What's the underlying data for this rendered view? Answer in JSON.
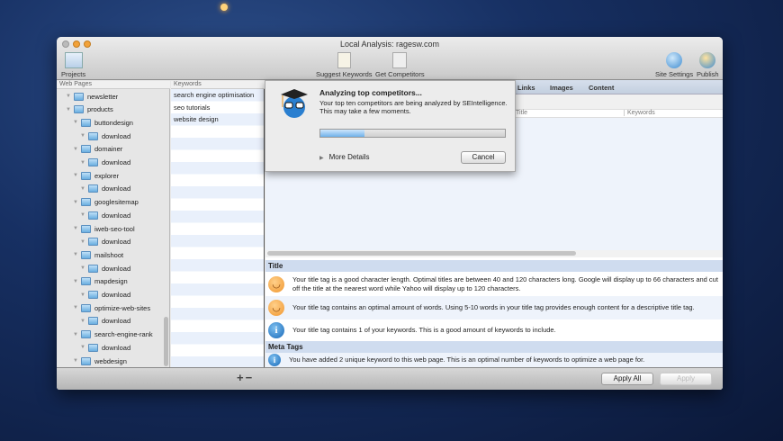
{
  "window": {
    "title": "Local Analysis: ragesw.com"
  },
  "toolbar": {
    "projects": "Projects",
    "suggest_keywords": "Suggest Keywords",
    "get_competitors": "Get Competitors",
    "site_settings": "Site Settings",
    "publish": "Publish"
  },
  "web_pages": {
    "header": "Web Pages",
    "items": [
      {
        "label": "newsletter",
        "level": 0
      },
      {
        "label": "products",
        "level": 0
      },
      {
        "label": "buttondesign",
        "level": 1
      },
      {
        "label": "download",
        "level": 2
      },
      {
        "label": "domainer",
        "level": 1
      },
      {
        "label": "download",
        "level": 2
      },
      {
        "label": "explorer",
        "level": 1
      },
      {
        "label": "download",
        "level": 2
      },
      {
        "label": "googlesitemap",
        "level": 1
      },
      {
        "label": "download",
        "level": 2
      },
      {
        "label": "iweb-seo-tool",
        "level": 1
      },
      {
        "label": "download",
        "level": 2
      },
      {
        "label": "mailshoot",
        "level": 1
      },
      {
        "label": "download",
        "level": 2
      },
      {
        "label": "mapdesign",
        "level": 1
      },
      {
        "label": "download",
        "level": 2
      },
      {
        "label": "optimize-web-sites",
        "level": 1
      },
      {
        "label": "download",
        "level": 2
      },
      {
        "label": "search-engine-rank",
        "level": 1
      },
      {
        "label": "download",
        "level": 2
      },
      {
        "label": "webdesign",
        "level": 1
      }
    ]
  },
  "keywords": {
    "header": "Keywords",
    "items": [
      "search engine optimisation",
      "seo tutorials",
      "website design"
    ]
  },
  "tabs": [
    "Links",
    "Images",
    "Content"
  ],
  "table": {
    "columns": [
      "Title",
      "Keywords"
    ]
  },
  "analysis": {
    "sections": [
      {
        "title": "Title"
      },
      {
        "title": "Meta Tags"
      }
    ],
    "messages": [
      {
        "icon": "smiley-icon",
        "text": "Your title tag is a good character length. Optimal titles are between 40 and 120 characters long. Google will display up to 66 characters and cut off the title at the nearest word while Yahoo will display up to 120 characters."
      },
      {
        "icon": "smiley-icon",
        "text": "Your title tag contains an optimal amount of words. Using 5-10 words in your title tag provides enough content for a descriptive title tag."
      },
      {
        "icon": "info-icon",
        "text": "Your title tag contains 1 of your keywords. This is a good amount of keywords to include."
      },
      {
        "icon": "info-icon",
        "text": "You have added 2 unique keyword to this web page. This is an optimal number of keywords to optimize a web page for."
      }
    ]
  },
  "bottom": {
    "add": "+",
    "remove": "−",
    "apply_all": "Apply All",
    "apply": "Apply"
  },
  "dialog": {
    "title": "Analyzing top competitors...",
    "text": "Your top ten competitors are being analyzed by SEIntelligence. This may take a few moments.",
    "progress_percent": 24,
    "more_details": "More Details",
    "cancel": "Cancel"
  }
}
